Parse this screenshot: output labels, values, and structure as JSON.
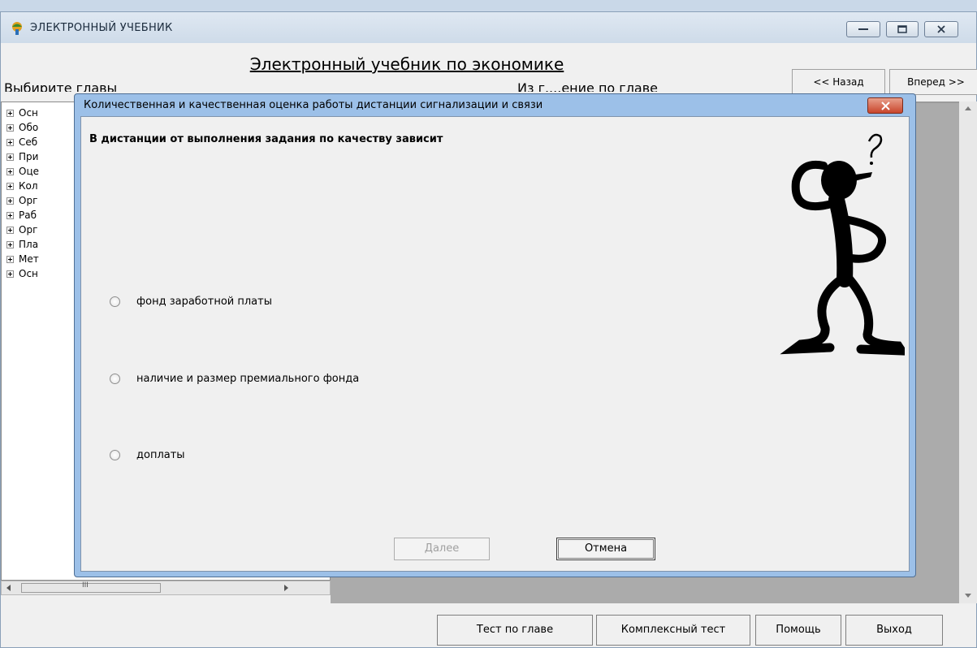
{
  "window": {
    "title": "ЭЛЕКТРОННЫЙ УЧЕБНИК"
  },
  "main": {
    "book_title": "Электронный учебник по экономике",
    "chapters_label": "Выбирите главы",
    "themes_label": "Из г....ение по главе",
    "nav_back": "<< Назад",
    "nav_forward": "Вперед >>",
    "tree_items": [
      "Осн",
      "Обо",
      "Себ",
      "При",
      "Оце",
      "Кол",
      "Орг",
      "Раб",
      "Орг",
      "Пла",
      "Мет",
      "Осн"
    ],
    "hscroll_grip": "III"
  },
  "footer": {
    "chapter_test": "Тест по главе",
    "complex_test": "Комплексный тест",
    "help": "Помощь",
    "exit": "Выход"
  },
  "dialog": {
    "title": "Количественная и качественная оценка работы дистанции сигнализации и связи",
    "question": "В дистанции от выполнения задания по качеству зависит",
    "options": [
      "фонд заработной платы",
      "наличие и размер премиального фонда",
      "доплаты"
    ],
    "next": "Далее",
    "cancel": "Отмена"
  },
  "colors": {
    "titlebar": "#cedbe9",
    "dialog_frame": "#9cc0e8",
    "close_red": "#c9452c",
    "face": "#f0f0f0"
  }
}
